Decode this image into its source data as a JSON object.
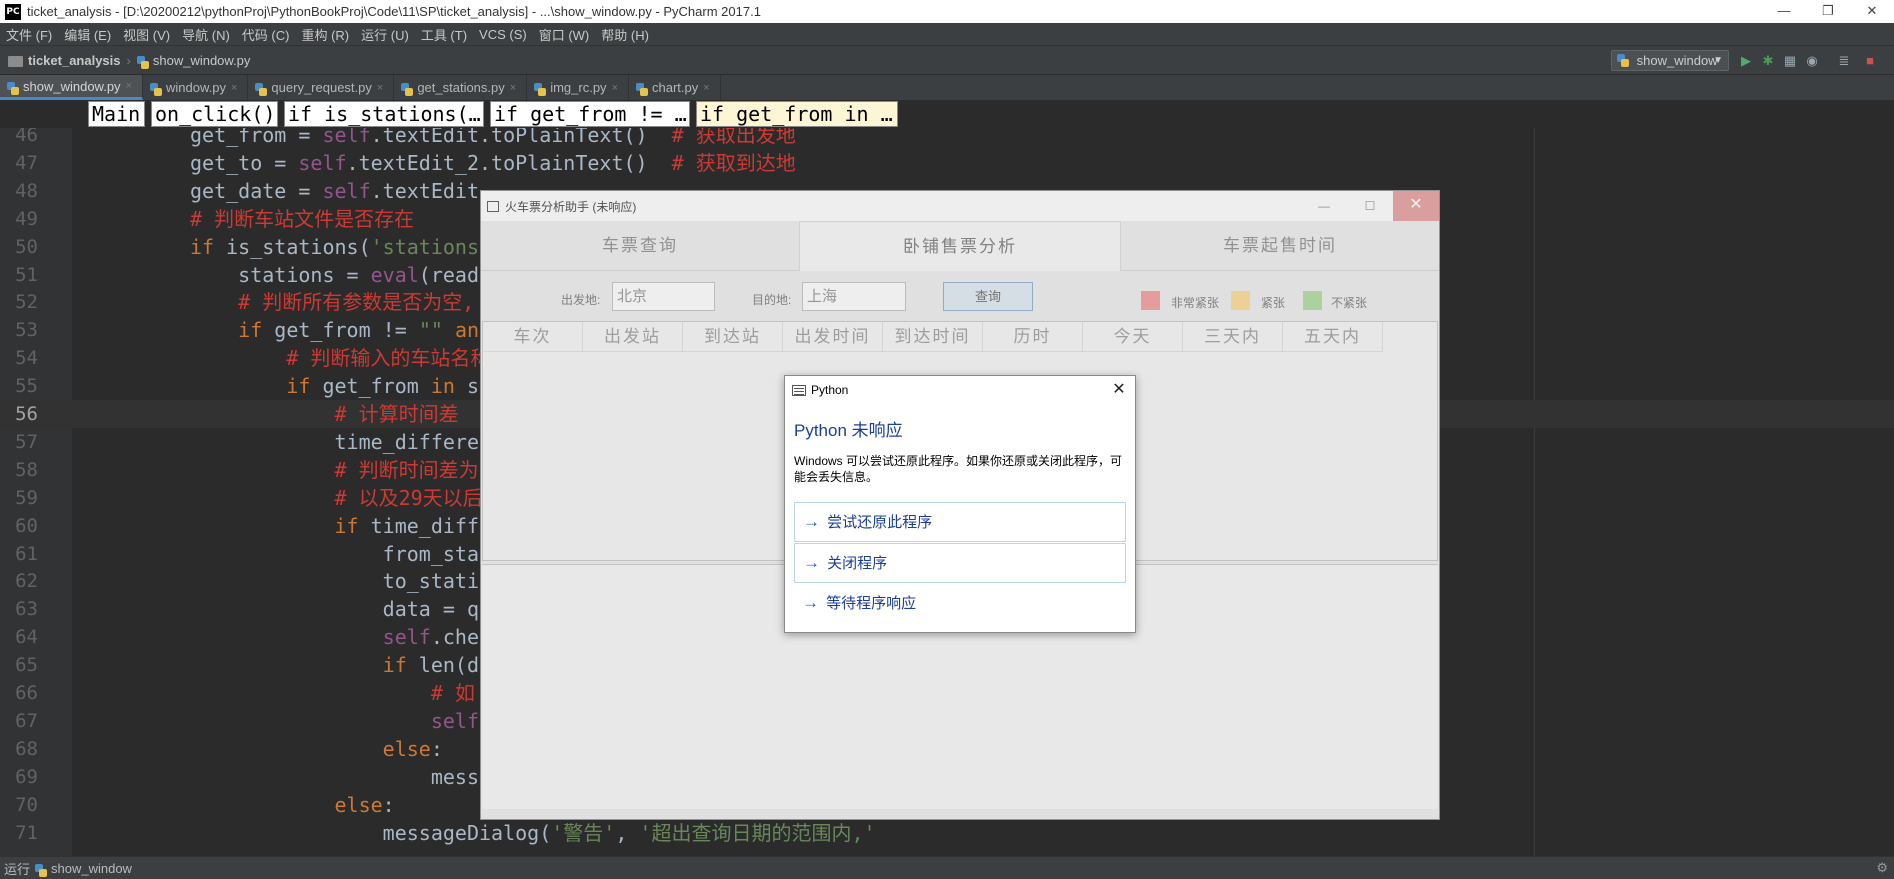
{
  "ide": {
    "window_title": "ticket_analysis - [D:\\20200212\\pythonProj\\PythonBookProj\\Code\\11\\SP\\ticket_analysis] - ...\\show_window.py - PyCharm 2017.1",
    "logo": "PC",
    "window_controls": [
      "—",
      "❐",
      "✕"
    ],
    "menu": [
      "文件 (F)",
      "编辑 (E)",
      "视图 (V)",
      "导航 (N)",
      "代码 (C)",
      "重构 (R)",
      "运行 (U)",
      "工具 (T)",
      "VCS (S)",
      "窗口 (W)",
      "帮助 (H)"
    ],
    "nav": {
      "project": "ticket_analysis",
      "file": "show_window.py"
    },
    "run_config": "show_window",
    "tabs": [
      "show_window.py",
      "window.py",
      "query_request.py",
      "get_stations.py",
      "img_rc.py",
      "chart.py"
    ],
    "active_tab": 0,
    "breadcrumbs": [
      "Main",
      "on_click()",
      "if is_stations(…",
      "if get_from != …",
      "if get_from in …"
    ],
    "status": {
      "label": "运行",
      "config": "show_window"
    },
    "colors": {
      "accent": "#4a88c7",
      "run_green": "#59a869",
      "debug_green": "#499c54",
      "stop_red": "#c75450"
    }
  },
  "code_lines": [
    {
      "n": "46",
      "html": "get_from = <span class=\"c-self\">self</span>.textEdit.toPlainText()  <span class=\"c-com\"># 获取出发地</span>"
    },
    {
      "n": "47",
      "html": "get_to = <span class=\"c-self\">self</span>.textEdit_2.toPlainText()  <span class=\"c-com\"># 获取到达地</span>"
    },
    {
      "n": "48",
      "html": "get_date = <span class=\"c-self\">self</span>.textEdit"
    },
    {
      "n": "49",
      "html": "<span class=\"c-com\"># 判断车站文件是否存在</span>"
    },
    {
      "n": "50",
      "html": "<span class=\"c-kw\">if</span> is_stations(<span class=\"c-str\">'stations</span>"
    },
    {
      "n": "51",
      "html": "    stations = <span class=\"c-self\">eval</span>(read"
    },
    {
      "n": "52",
      "html": "    <span class=\"c-com\"># 判断所有参数是否为空,</span>"
    },
    {
      "n": "53",
      "html": "    <span class=\"c-kw\">if</span> get_from != <span class=\"c-str\">\"\"</span> <span class=\"c-kw\">an</span>"
    },
    {
      "n": "54",
      "html": "        <span class=\"c-com\"># 判断输入的车站名称</span>"
    },
    {
      "n": "55",
      "html": "        <span class=\"c-kw\">if</span> get_from <span class=\"c-kw\">in</span> s"
    },
    {
      "n": "56",
      "html": "            <span class=\"c-com\"># 计算时间差</span>"
    },
    {
      "n": "57",
      "html": "            time_differe"
    },
    {
      "n": "58",
      "html": "            <span class=\"c-com\"># 判断时间差为</span>"
    },
    {
      "n": "59",
      "html": "            <span class=\"c-com\"># 以及29天以后</span>"
    },
    {
      "n": "60",
      "html": "            <span class=\"c-kw\">if</span> time_diff"
    },
    {
      "n": "61",
      "html": "                from_sta"
    },
    {
      "n": "62",
      "html": "                to_stati"
    },
    {
      "n": "63",
      "html": "                data = q"
    },
    {
      "n": "64",
      "html": "                <span class=\"c-self\">self</span>.che"
    },
    {
      "n": "65",
      "html": "                <span class=\"c-kw\">if</span> len(d"
    },
    {
      "n": "66",
      "html": "                    <span class=\"c-com\"># 如</span>"
    },
    {
      "n": "67",
      "html": "                    <span class=\"c-self\">self</span>"
    },
    {
      "n": "68",
      "html": "                <span class=\"c-kw\">else</span>:"
    },
    {
      "n": "69",
      "html": "                    mess"
    },
    {
      "n": "70",
      "html": "            <span class=\"c-kw\">else</span>:"
    },
    {
      "n": "71",
      "html": "                messageDialog(<span class=\"c-str\">'警告'</span>, <span class=\"c-str\">'超出查询日期的范围内,'</span>"
    }
  ],
  "current_line": "56",
  "app": {
    "title": "火车票分析助手 (未响应)",
    "window_controls": [
      "—",
      "☐",
      "✕"
    ],
    "tabs": [
      "车票查询",
      "卧铺售票分析",
      "车票起售时间"
    ],
    "active_tab": 1,
    "from_label": "出发地:",
    "from_value": "北京",
    "to_label": "目的地:",
    "to_value": "上海",
    "query_button": "查询",
    "legend": [
      {
        "label": "非常紧张",
        "color": "#f4a6a6"
      },
      {
        "label": "紧张",
        "color": "#fce0a0"
      },
      {
        "label": "不紧张",
        "color": "#b9e0a8"
      }
    ],
    "columns": [
      "车次",
      "出发站",
      "到达站",
      "出发时间",
      "到达时间",
      "历时",
      "今天",
      "三天内",
      "五天内"
    ]
  },
  "dialog": {
    "title": "Python",
    "close": "✕",
    "heading": "Python 未响应",
    "message": "Windows 可以尝试还原此程序。如果你还原或关闭此程序，可能会丢失信息。",
    "options": [
      "尝试还原此程序",
      "关闭程序",
      "等待程序响应"
    ]
  }
}
